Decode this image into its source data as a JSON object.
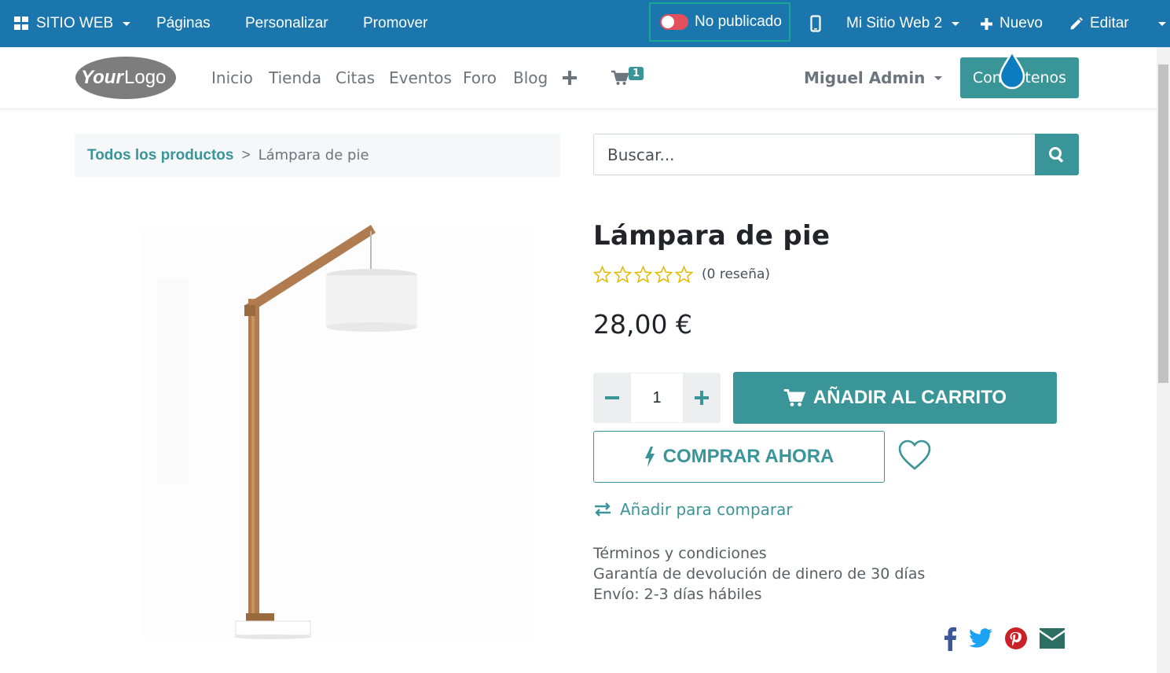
{
  "adminbar": {
    "app_label": "SITIO WEB",
    "menus": [
      "Páginas",
      "Personalizar",
      "Promover"
    ],
    "publish_status": "No publicado",
    "website_selector": "Mi Sitio Web 2",
    "new_label": "Nuevo",
    "edit_label": "Editar"
  },
  "header": {
    "logo_text": "YourLogo",
    "nav": [
      "Inicio",
      "Tienda",
      "Citas",
      "Eventos",
      "Foro",
      "Blog"
    ],
    "cart_count": "1",
    "user": "Miguel Admin",
    "cta_label": "Contáctenos"
  },
  "breadcrumb": {
    "parent": "Todos los productos",
    "separator": ">",
    "current": "Lámpara de pie"
  },
  "search": {
    "placeholder": "Buscar..."
  },
  "product": {
    "name": "Lámpara de pie",
    "rating": 0,
    "reviews": "(0 reseña)",
    "price": "28,00 €",
    "quantity": "1",
    "add_to_cart": "AÑADIR AL CARRITO",
    "buy_now": "COMPRAR AHORA",
    "compare": "Añadir para comparar",
    "terms": [
      "Términos y condiciones",
      "Garantía de devolución de dinero de 30 días",
      "Envío: 2-3 días hábiles"
    ]
  },
  "colors": {
    "adminbar": "#1a76ad",
    "accent": "#3a9599",
    "toggle_off": "#e2505e",
    "highlight": "#17a797"
  }
}
